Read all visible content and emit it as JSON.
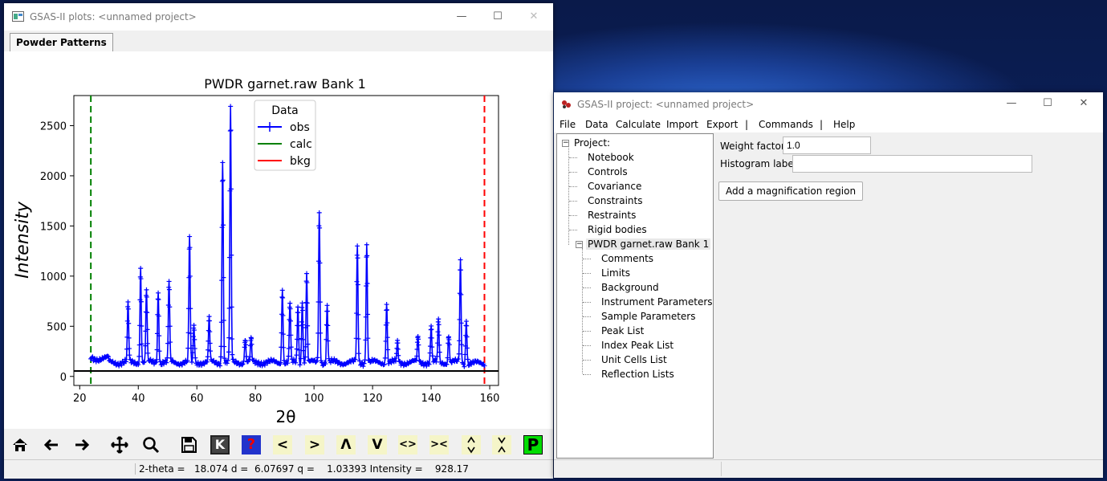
{
  "plot_window": {
    "title": "GSAS-II plots: <unnamed project>",
    "tab": "Powder Patterns",
    "status": "2-theta =   18.074 d =  6.07697 q =    1.03393 Intensity =    928.17",
    "toolbar": {
      "home": "home-icon",
      "back": "back-arrow-icon",
      "forward": "forward-arrow-icon",
      "pan": "pan-icon",
      "zoom": "zoom-icon",
      "save": "save-icon",
      "k": "K",
      "help": "?",
      "left": "<",
      "right": ">",
      "up": "Λ",
      "down": "V",
      "expand": "<>",
      "contract": "><",
      "vexpand": "vertical-expand-icon",
      "vcontract": "vertical-contract-icon",
      "p": "P"
    }
  },
  "project_window": {
    "title": "GSAS-II project: <unnamed project>",
    "menus": [
      "File",
      "Data",
      "Calculate",
      "Import",
      "Export",
      "|",
      "Commands",
      "|",
      "Help"
    ],
    "tree": {
      "root": "Project:",
      "children": [
        "Notebook",
        "Controls",
        "Covariance",
        "Constraints",
        "Restraints",
        "Rigid bodies"
      ],
      "histogram": "PWDR garnet.raw Bank 1",
      "hist_children": [
        "Comments",
        "Limits",
        "Background",
        "Instrument Parameters",
        "Sample Parameters",
        "Peak List",
        "Index Peak List",
        "Unit Cells List",
        "Reflection Lists"
      ]
    },
    "weight_label": "Weight factor:",
    "weight_value": "1.0",
    "hist_label": "Histogram label:",
    "hist_value": "",
    "mag_button": "Add a magnification region"
  },
  "chart_data": {
    "type": "line",
    "title": "PWDR garnet.raw Bank 1",
    "xlabel": "2θ",
    "ylabel": "Intensity",
    "xlim": [
      18,
      163
    ],
    "ylim": [
      -90,
      2800
    ],
    "xticks": [
      20,
      40,
      60,
      80,
      100,
      120,
      140,
      160
    ],
    "yticks": [
      0,
      500,
      1000,
      1500,
      2000,
      2500
    ],
    "legend": {
      "title": "Data",
      "placement": "top-center",
      "entries": [
        "obs",
        "calc",
        "bkg"
      ]
    },
    "colors": {
      "obs": "#0000ff",
      "calc": "#008000",
      "bkg": "#ff0000"
    },
    "limits": [
      23.8,
      158.2
    ],
    "x_range": [
      23.8,
      158.2
    ],
    "baseline": 140,
    "peaks": [
      [
        36.5,
        710
      ],
      [
        40.8,
        1080
      ],
      [
        42.8,
        860
      ],
      [
        46.8,
        850
      ],
      [
        50.5,
        940
      ],
      [
        57.5,
        1380
      ],
      [
        59.0,
        500
      ],
      [
        64.2,
        580
      ],
      [
        68.8,
        2160
      ],
      [
        71.5,
        2660
      ],
      [
        76.5,
        380
      ],
      [
        78.5,
        360
      ],
      [
        89.2,
        880
      ],
      [
        91.8,
        730
      ],
      [
        94.5,
        700
      ],
      [
        96.0,
        750
      ],
      [
        97.5,
        1020
      ],
      [
        101.8,
        1630
      ],
      [
        104.5,
        700
      ],
      [
        114.8,
        1290
      ],
      [
        118.0,
        1310
      ],
      [
        124.8,
        730
      ],
      [
        128.5,
        330
      ],
      [
        135.5,
        390
      ],
      [
        140.0,
        500
      ],
      [
        142.5,
        560
      ],
      [
        146.0,
        420
      ],
      [
        150.0,
        1150
      ],
      [
        152.0,
        580
      ]
    ]
  }
}
